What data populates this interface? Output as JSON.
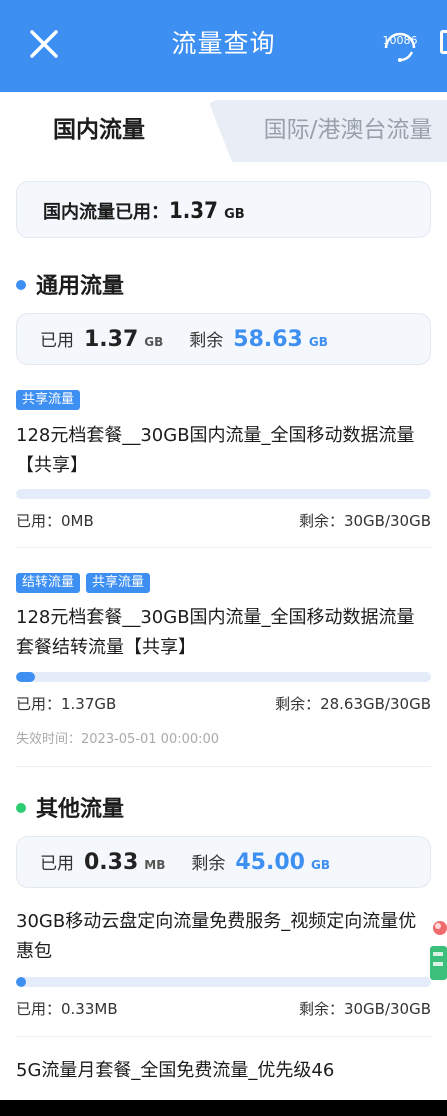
{
  "header": {
    "title": "流量查询",
    "service_label": "10086"
  },
  "tabs": {
    "domestic": "国内流量",
    "international": "国际/港澳台流量"
  },
  "summary": {
    "label": "国内流量已用：",
    "value": "1.37",
    "unit": "GB"
  },
  "general": {
    "title": "通用流量",
    "used_label": "已用",
    "used_value": "1.37",
    "used_unit": "GB",
    "remain_label": "剩余",
    "remain_value": "58.63",
    "remain_unit": "GB"
  },
  "packages": [
    {
      "tags": [
        "共享流量"
      ],
      "name": "128元档套餐__30GB国内流量_全国移动数据流量【共享】",
      "used": "已用：0MB",
      "remain": "剩余：30GB/30GB",
      "progress": 0
    },
    {
      "tags": [
        "结转流量",
        "共享流量"
      ],
      "name": "128元档套餐__30GB国内流量_全国移动数据流量套餐结转流量【共享】",
      "used": "已用：1.37GB",
      "remain": "剩余：28.63GB/30GB",
      "expire": "失效时间：2023-05-01 00:00:00",
      "progress": 0.0457
    }
  ],
  "other": {
    "title": "其他流量",
    "used_label": "已用",
    "used_value": "0.33",
    "used_unit": "MB",
    "remain_label": "剩余",
    "remain_value": "45.00",
    "remain_unit": "GB"
  },
  "other_packages": [
    {
      "name": "30GB移动云盘定向流量免费服务_视频定向流量优惠包",
      "used": "已用：0.33MB",
      "remain": "剩余：30GB/30GB",
      "progress": 0.01
    },
    {
      "name": "5G流量月套餐_全国免费流量_优先级46"
    }
  ],
  "colors": {
    "accent": "#3d8ff2",
    "general_dot": "#3d8ff2",
    "other_dot": "#2ecc71"
  }
}
